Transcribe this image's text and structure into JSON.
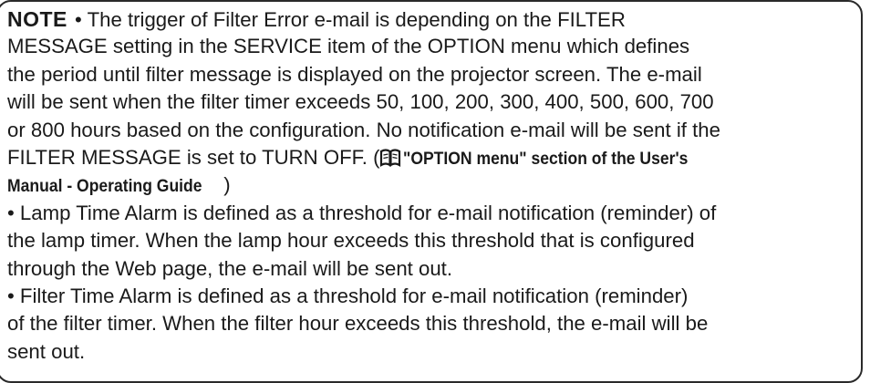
{
  "note": {
    "label": "NOTE",
    "para1": {
      "line1": " • The trigger of Filter Error e-mail is depending on the FILTER",
      "line2": "MESSAGE setting in the SERVICE item of the OPTION menu which defines",
      "line3": "the period until filter message is displayed on the projector screen. The e-mail",
      "line4": "will be sent when the filter timer exceeds 50, 100, 200, 300, 400, 500, 600, 700",
      "line5": "or 800 hours based on the configuration. No notification e-mail will be sent if the",
      "line6_text": "FILTER MESSAGE is set to TURN OFF. (",
      "reference_line1": "\"OPTION menu\" section of the User's",
      "reference_line2": "Manual - Operating Guide",
      "close_paren": ")"
    },
    "para2": {
      "line1": "• Lamp Time Alarm is defined as a threshold for e-mail notification (reminder) of",
      "line2": "the lamp timer. When the lamp hour exceeds this threshold that is configured",
      "line3": "through the Web page, the e-mail will be sent out."
    },
    "para3": {
      "line1": "• Filter Time Alarm is defined as a threshold for e-mail notification (reminder)",
      "line2": "of the filter timer. When the filter hour exceeds this threshold, the e-mail will be",
      "line3": "sent out."
    },
    "icons": {
      "reference": "book-icon"
    }
  }
}
